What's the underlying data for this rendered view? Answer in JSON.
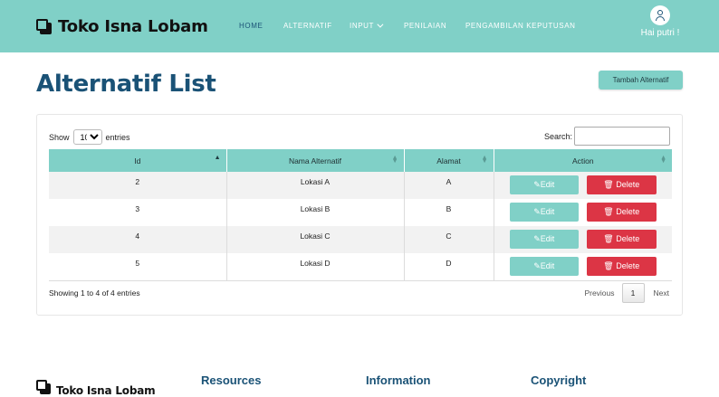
{
  "brand": {
    "name": "Toko Isna Lobam"
  },
  "nav": {
    "items": [
      {
        "label": "HOME",
        "active": true
      },
      {
        "label": "ALTERNATIF"
      },
      {
        "label": "INPUT"
      },
      {
        "label": "PENILAIAN"
      },
      {
        "label": "PENGAMBILAN KEPUTUSAN"
      }
    ]
  },
  "user": {
    "greeting": "Hai putri !",
    "icon": "user-icon"
  },
  "page": {
    "title": "Alternatif List",
    "add_button": "Tambah Alternatif"
  },
  "table_controls": {
    "show_label": "Show",
    "entries_label": "entries",
    "page_size": "10",
    "search_label": "Search:",
    "search_value": ""
  },
  "table": {
    "columns": [
      "Id",
      "Nama Alternatif",
      "Alamat",
      "Action"
    ],
    "rows": [
      {
        "id": "2",
        "nama": "Lokasi A",
        "alamat": "A"
      },
      {
        "id": "3",
        "nama": "Lokasi B",
        "alamat": "B"
      },
      {
        "id": "4",
        "nama": "Lokasi C",
        "alamat": "C"
      },
      {
        "id": "5",
        "nama": "Lokasi D",
        "alamat": "D"
      }
    ],
    "edit_label": "✎Edit",
    "delete_label": "🗑 Delete"
  },
  "pagination": {
    "info": "Showing 1 to 4 of 4 entries",
    "previous": "Previous",
    "current": "1",
    "next": "Next"
  },
  "footer": {
    "brand": "Toko Isna Lobam",
    "columns": [
      "Resources",
      "Information",
      "Copyright"
    ]
  },
  "colors": {
    "accent": "#80d0c7",
    "title": "#1a5276",
    "danger": "#dc3545"
  }
}
